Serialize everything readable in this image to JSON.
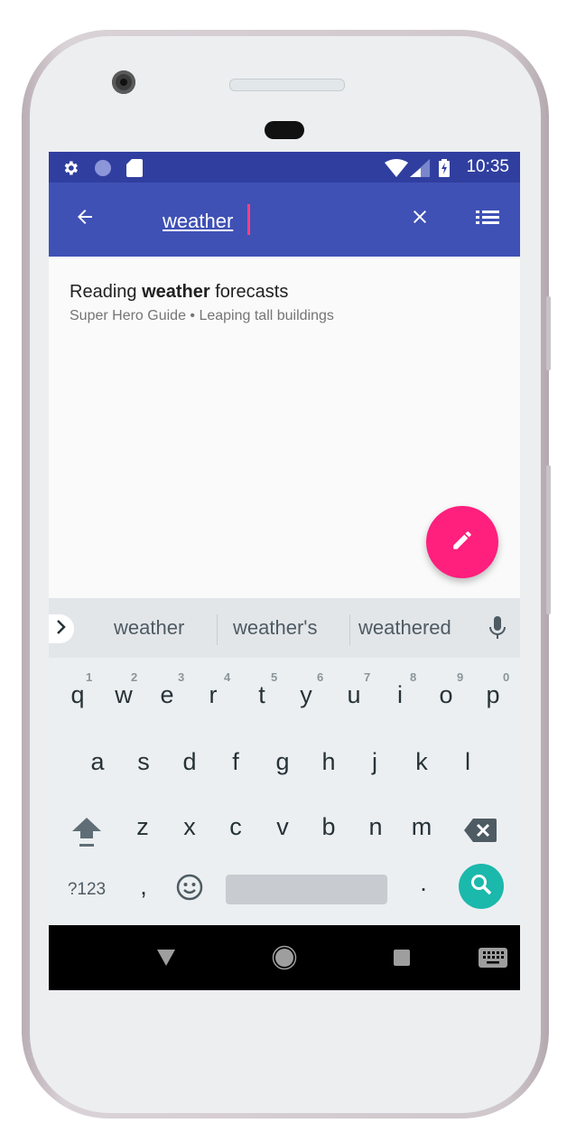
{
  "status_bar": {
    "time": "10:35",
    "left_icons": [
      "settings-icon",
      "sync-icon",
      "sd-card-icon"
    ],
    "right_icons": [
      "wifi-icon",
      "signal-icon",
      "battery-charging-icon"
    ]
  },
  "toolbar": {
    "back_icon": "arrow-left-icon",
    "search_value": "weather",
    "clear_icon": "close-icon",
    "list_icon": "list-icon"
  },
  "results": [
    {
      "title_pre": "Reading ",
      "title_match": "weather",
      "title_post": " forecasts",
      "subtitle": "Super Hero Guide • Leaping tall buildings"
    }
  ],
  "fab": {
    "icon": "pencil-icon",
    "color": "#ff1f7d"
  },
  "keyboard": {
    "suggestions": [
      "weather",
      "weather's",
      "weathered"
    ],
    "row1": [
      "q",
      "w",
      "e",
      "r",
      "t",
      "y",
      "u",
      "i",
      "o",
      "p"
    ],
    "row1_hints": [
      "1",
      "2",
      "3",
      "4",
      "5",
      "6",
      "7",
      "8",
      "9",
      "0"
    ],
    "row2": [
      "a",
      "s",
      "d",
      "f",
      "g",
      "h",
      "j",
      "k",
      "l"
    ],
    "row3": [
      "z",
      "x",
      "c",
      "v",
      "b",
      "n",
      "m"
    ],
    "symbols_label": "?123",
    "comma": ",",
    "period": ".",
    "action_color": "#1bb8ac"
  },
  "nav_bar": {
    "buttons": [
      "back-icon",
      "home-icon",
      "recents-icon",
      "keyboard-switch-icon"
    ]
  },
  "colors": {
    "status_bar": "#303f9f",
    "toolbar": "#3f51b5",
    "accent": "#ff4081"
  }
}
